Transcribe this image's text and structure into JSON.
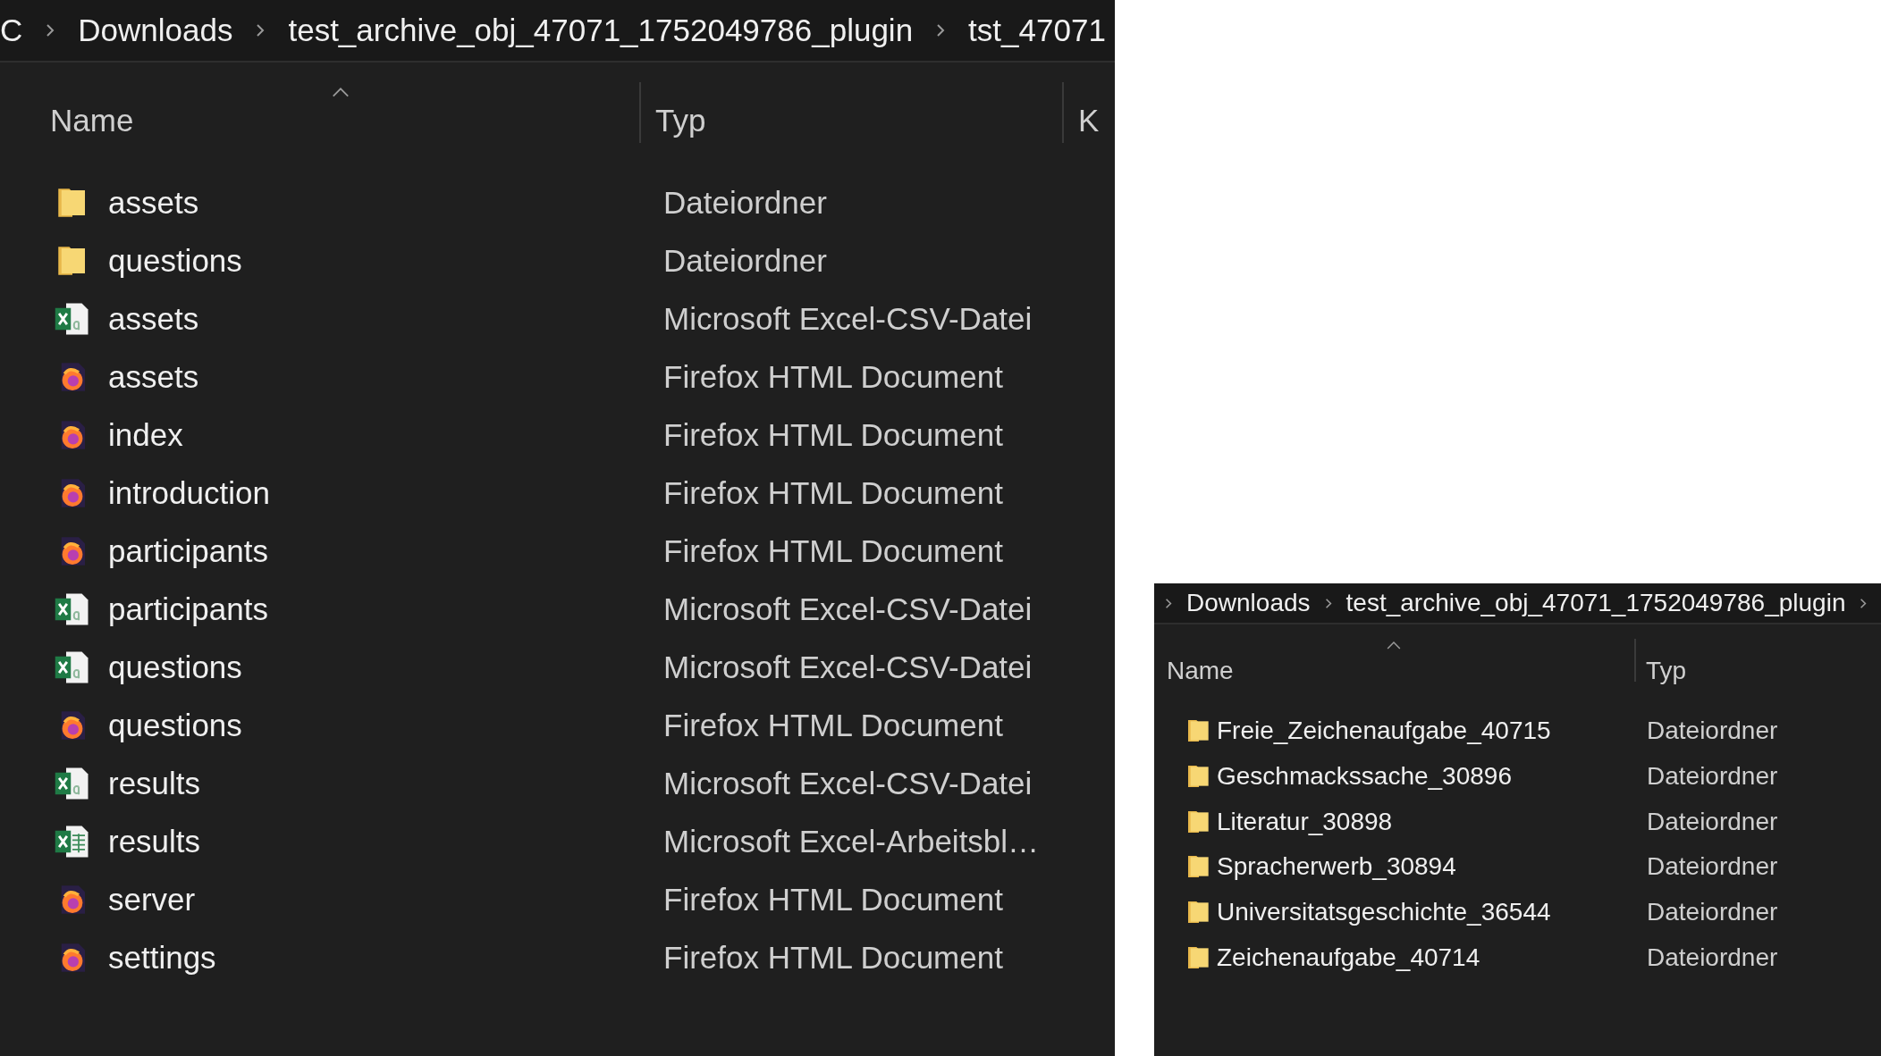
{
  "panels": [
    {
      "breadcrumb": [
        "C",
        "Downloads",
        "test_archive_obj_47071_1752049786_plugin",
        "tst_47071"
      ],
      "leading_chevron": false,
      "trailing_chevron": false,
      "columns": [
        {
          "label": "Name",
          "sorted": true
        },
        {
          "label": "Typ",
          "sorted": false
        },
        {
          "label": "K",
          "sorted": false
        }
      ],
      "rows": [
        {
          "kind": "folder",
          "name": "assets",
          "type": "Dateiordner"
        },
        {
          "kind": "folder",
          "name": "questions",
          "type": "Dateiordner"
        },
        {
          "kind": "csv",
          "name": "assets",
          "type": "Microsoft Excel-CSV-Datei"
        },
        {
          "kind": "html",
          "name": "assets",
          "type": "Firefox HTML Document"
        },
        {
          "kind": "html",
          "name": "index",
          "type": "Firefox HTML Document"
        },
        {
          "kind": "html",
          "name": "introduction",
          "type": "Firefox HTML Document"
        },
        {
          "kind": "html",
          "name": "participants",
          "type": "Firefox HTML Document"
        },
        {
          "kind": "csv",
          "name": "participants",
          "type": "Microsoft Excel-CSV-Datei"
        },
        {
          "kind": "csv",
          "name": "questions",
          "type": "Microsoft Excel-CSV-Datei"
        },
        {
          "kind": "html",
          "name": "questions",
          "type": "Firefox HTML Document"
        },
        {
          "kind": "csv",
          "name": "results",
          "type": "Microsoft Excel-CSV-Datei"
        },
        {
          "kind": "xlsx",
          "name": "results",
          "type": "Microsoft Excel-Arbeitsbl…"
        },
        {
          "kind": "html",
          "name": "server",
          "type": "Firefox HTML Document"
        },
        {
          "kind": "html",
          "name": "settings",
          "type": "Firefox HTML Document"
        }
      ]
    },
    {
      "breadcrumb": [
        "Downloads",
        "test_archive_obj_47071_1752049786_plugin"
      ],
      "leading_chevron": true,
      "trailing_chevron": true,
      "columns": [
        {
          "label": "Name",
          "sorted": true
        },
        {
          "label": "Typ",
          "sorted": false
        }
      ],
      "rows": [
        {
          "kind": "folder",
          "name": "Freie_Zeichenaufgabe_40715",
          "type": "Dateiordner"
        },
        {
          "kind": "folder",
          "name": "Geschmackssache_30896",
          "type": "Dateiordner"
        },
        {
          "kind": "folder",
          "name": "Literatur_30898",
          "type": "Dateiordner"
        },
        {
          "kind": "folder",
          "name": "Spracherwerb_30894",
          "type": "Dateiordner"
        },
        {
          "kind": "folder",
          "name": "Universitatsgeschichte_36544",
          "type": "Dateiordner"
        },
        {
          "kind": "folder",
          "name": "Zeichenaufgabe_40714",
          "type": "Dateiordner"
        }
      ]
    }
  ]
}
